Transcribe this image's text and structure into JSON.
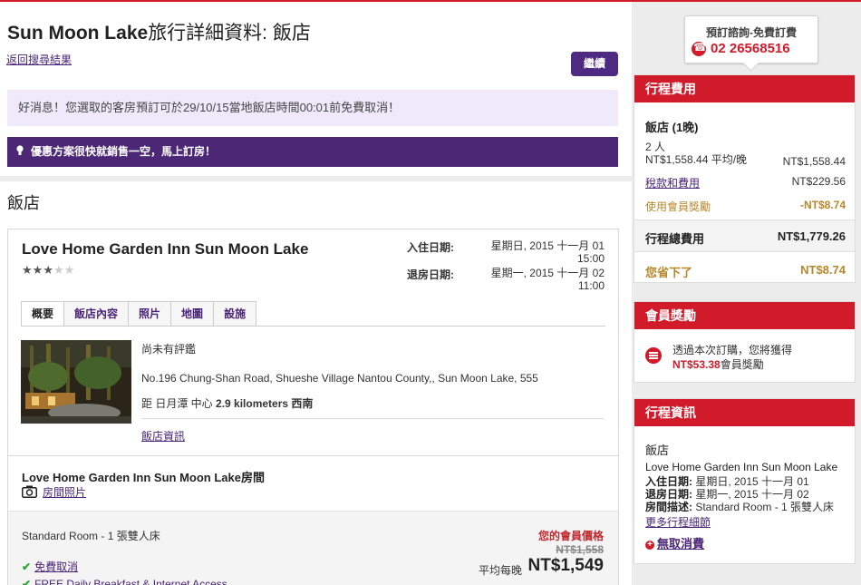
{
  "header": {
    "title_latin": "Sun Moon Lake",
    "title_cjk": "旅行詳細資料: 飯店",
    "back_link": "返回搜尋結果",
    "continue_button": "繼續"
  },
  "notices": {
    "good_news": "好消息！您選取的客房預訂可於29/10/15當地飯店時間00:01前免費取消！",
    "deal": "優惠方案很快就銷售一空，馬上訂房！"
  },
  "section_title": "飯店",
  "hotel": {
    "name": "Love Home Garden Inn Sun Moon Lake",
    "rating_filled": 3,
    "rating_total": 5,
    "checkin_label": "入住日期:",
    "checkin_value": "星期日, 2015 十一月 01 15:00",
    "checkout_label": "退房日期:",
    "checkout_value": "星期一, 2015 十一月 02 11:00",
    "tabs": [
      "概要",
      "飯店內容",
      "照片",
      "地圖",
      "設施"
    ],
    "active_tab": 0,
    "review": "尚未有評鑑",
    "address": "No.196 Chung-Shan Road, Shueshe Village Nantou County,, Sun Moon Lake, 555",
    "distance_prefix": "距 日月潭 中心 ",
    "distance_value": "2.9 kilometers 西南",
    "info_link": "飯店資訊"
  },
  "room": {
    "section_title": "Love Home Garden Inn Sun Moon Lake房間",
    "photo_link": "房間照片",
    "type": "Standard Room - 1 張雙人床",
    "member_price_label": "您的會員價格",
    "old_price": "NT$1,558",
    "avg_label": "平均每晚",
    "avg_price": "NT$1,549",
    "perks": [
      "免費取消",
      "FREE Daily Breakfast & Internet Access"
    ]
  },
  "phone": {
    "label": "預訂諮詢-免費訂費",
    "number": "02 26568516"
  },
  "cost": {
    "title": "行程費用",
    "hotel_line": "飯店 (1晚)",
    "people": "2 人",
    "per_night": "NT$1,558.44 平均/晚",
    "per_night_total": "NT$1,558.44",
    "tax_label": "稅款和費用",
    "tax_value": "NT$229.56",
    "reward_label": "使用會員獎勵",
    "reward_value": "-NT$8.74",
    "total_label": "行程總費用",
    "total_value": "NT$1,779.26",
    "save_label": "您省下了",
    "save_value": "NT$8.74"
  },
  "rewards": {
    "title": "會員獎勵",
    "line1": "透過本次訂購，您將獲得",
    "amount": "NT$53.38",
    "line2_suffix": "會員獎勵"
  },
  "trip": {
    "title": "行程資訊",
    "hotel_label": "飯店",
    "name": "Love Home Garden Inn Sun Moon Lake",
    "checkin_label": "入住日期:",
    "checkin_value": " 星期日, 2015 十一月 01",
    "checkout_label": "退房日期:",
    "checkout_value": " 星期一, 2015 十一月 02",
    "room_label": "房間描述:",
    "room_value": " Standard Room - 1 張雙人床",
    "more_link": "更多行程細節",
    "no_fee": "無取消費"
  },
  "colors": {
    "brand_red": "#d11a2a",
    "brand_purple": "#4b2776",
    "notice_bg": "#efe9fb",
    "gold": "#b8872b"
  }
}
